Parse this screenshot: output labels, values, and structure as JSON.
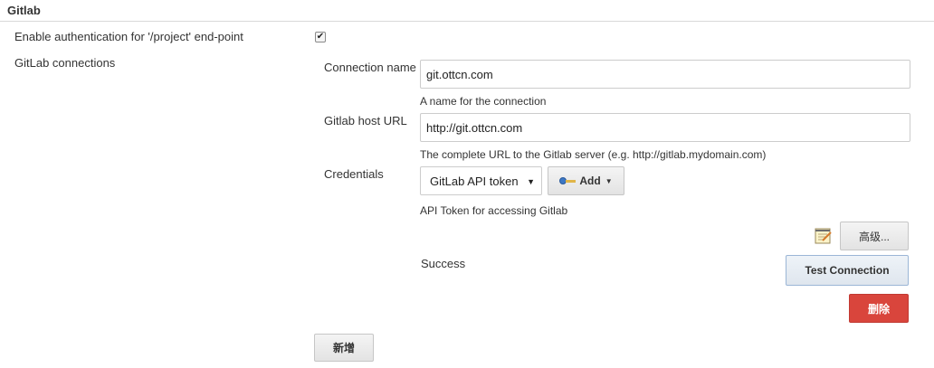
{
  "section": {
    "title": "Gitlab"
  },
  "auth": {
    "label": "Enable authentication for '/project' end-point",
    "checked": true,
    "check_glyph": "✔"
  },
  "connections": {
    "label": "GitLab connections",
    "connection_name": {
      "label": "Connection name",
      "value": "git.ottcn.com",
      "help": "A name for the connection"
    },
    "host_url": {
      "label": "Gitlab host URL",
      "value": "http://git.ottcn.com",
      "help": "The complete URL to the Gitlab server (e.g. http://gitlab.mydomain.com)"
    },
    "credentials": {
      "label": "Credentials",
      "selected": "GitLab API token",
      "caret": "▼",
      "add_label": "Add",
      "add_caret": "▼",
      "add_icon": "key-icon",
      "help": "API Token for accessing Gitlab"
    },
    "advanced_label": "高级...",
    "notepad_icon": "notepad-icon",
    "status": "Success",
    "test_label": "Test Connection",
    "delete_label": "删除",
    "delete_color": "#d9453c"
  },
  "new_label": "新增"
}
